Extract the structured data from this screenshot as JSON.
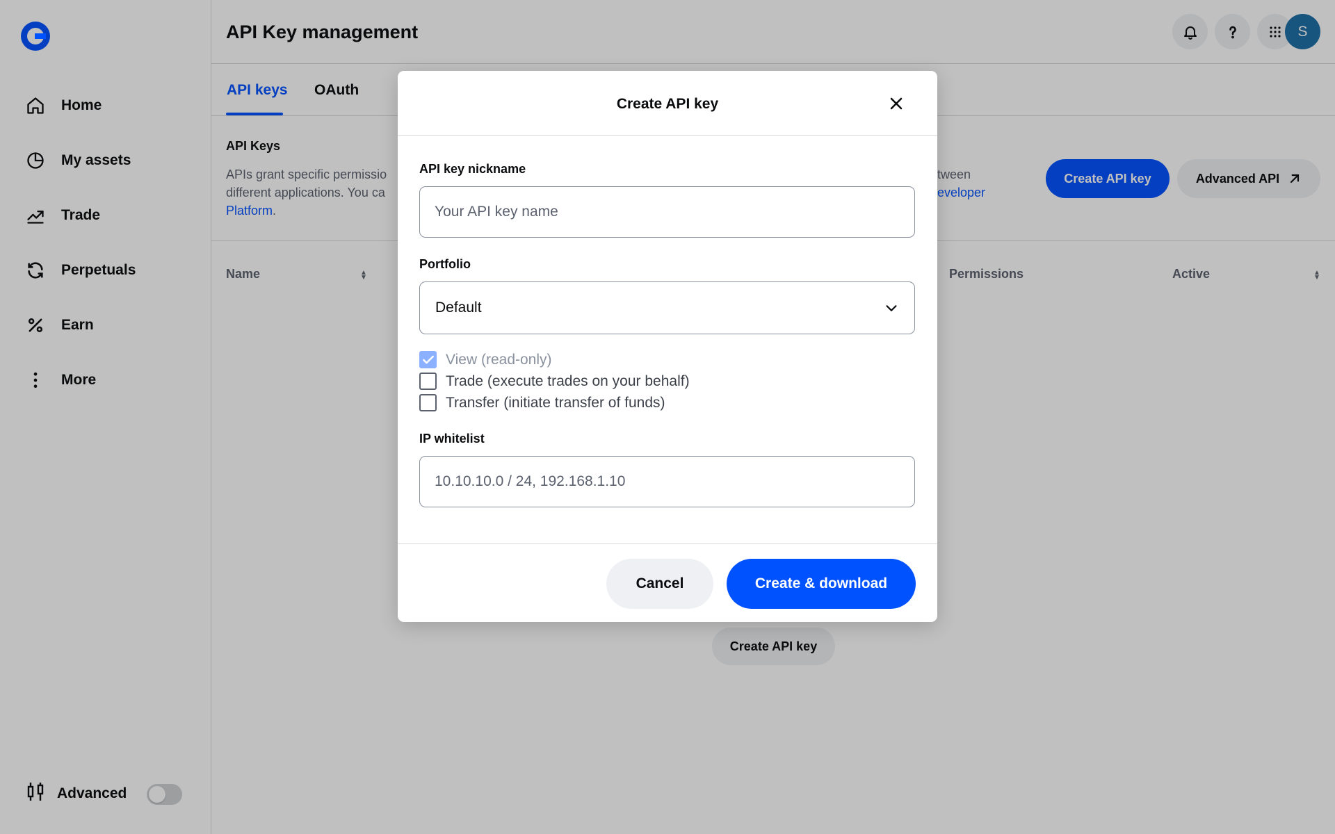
{
  "app": {
    "page_title": "API Key management",
    "avatar_initial": "S"
  },
  "sidebar": {
    "items": [
      {
        "label": "Home",
        "icon": "home-icon"
      },
      {
        "label": "My assets",
        "icon": "pie-chart-icon"
      },
      {
        "label": "Trade",
        "icon": "trending-up-icon"
      },
      {
        "label": "Perpetuals",
        "icon": "refresh-icon"
      },
      {
        "label": "Earn",
        "icon": "percent-icon"
      },
      {
        "label": "More",
        "icon": "more-vertical-icon"
      }
    ],
    "advanced_label": "Advanced",
    "advanced_enabled": false
  },
  "tabs": [
    {
      "label": "API keys",
      "active": true
    },
    {
      "label": "OAuth",
      "active": false
    }
  ],
  "content": {
    "section_title": "API Keys",
    "desc_line1_left": "APIs grant specific permissio",
    "desc_line1_right": "tween",
    "desc_line2_left": "different applications. You ca",
    "desc_line2_right": "eveloper",
    "desc_line3": "Platform",
    "desc_line3_suffix": ".",
    "create_button": "Create API key",
    "advanced_api_button": "Advanced API",
    "table_headers": {
      "name": "Name",
      "permissions": "Permissions",
      "active": "Active"
    },
    "empty_create_button": "Create API key"
  },
  "modal": {
    "title": "Create API key",
    "nickname_label": "API key nickname",
    "nickname_value": "",
    "nickname_placeholder": "Your API key name",
    "portfolio_label": "Portfolio",
    "portfolio_value": "Default",
    "permissions": [
      {
        "label": "View (read-only)",
        "checked": true,
        "disabled": true
      },
      {
        "label": "Trade (execute trades on your behalf)",
        "checked": false,
        "disabled": false
      },
      {
        "label": "Transfer (initiate transfer of funds)",
        "checked": false,
        "disabled": false
      }
    ],
    "ip_label": "IP whitelist",
    "ip_value": "",
    "ip_placeholder": "10.10.10.0 / 24, 192.168.1.10",
    "cancel_button": "Cancel",
    "submit_button": "Create & download"
  },
  "colors": {
    "brand_blue": "#0052ff",
    "avatar": "#1b6fa8"
  }
}
